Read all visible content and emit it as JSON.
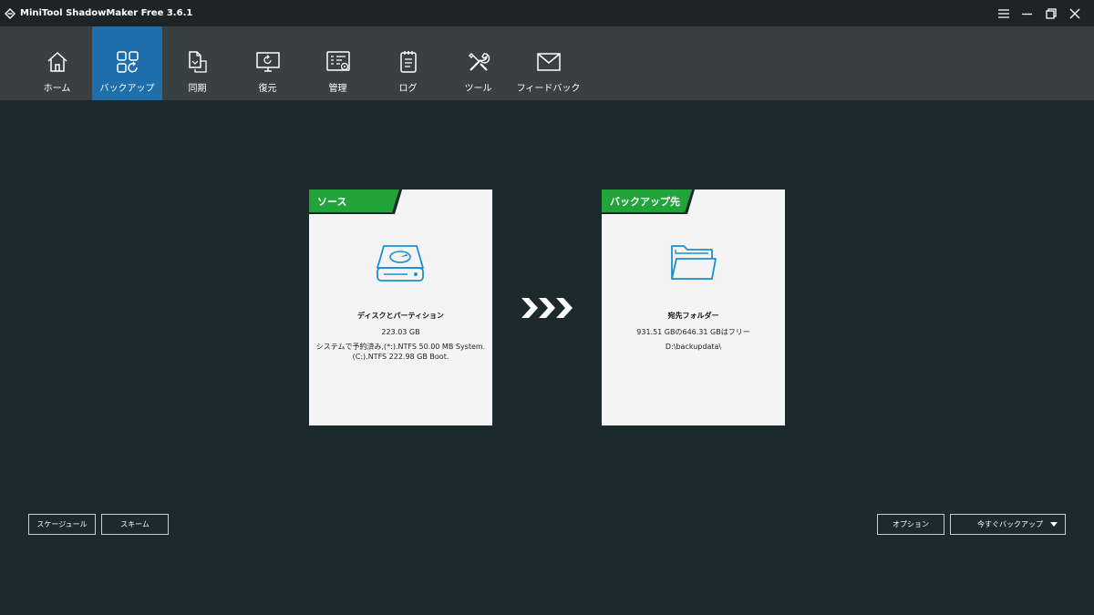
{
  "window": {
    "title": "MiniTool ShadowMaker Free 3.6.1",
    "controls": [
      "menu-icon",
      "minimize-icon",
      "restore-icon",
      "close-icon"
    ]
  },
  "nav": {
    "items": [
      {
        "label": "ホーム",
        "icon": "home-icon"
      },
      {
        "label": "バックアップ",
        "icon": "backup-icon",
        "active": true
      },
      {
        "label": "同期",
        "icon": "sync-icon"
      },
      {
        "label": "復元",
        "icon": "restore-monitor-icon"
      },
      {
        "label": "管理",
        "icon": "manage-icon"
      },
      {
        "label": "ログ",
        "icon": "log-icon"
      },
      {
        "label": "ツール",
        "icon": "tools-icon"
      },
      {
        "label": "フィードバック",
        "icon": "feedback-mail-icon"
      }
    ]
  },
  "source": {
    "tab_label": "ソース",
    "name": "ディスクとパーティション",
    "size": "223.03 GB",
    "detail_1": "システムで予約済み,(*:).NTFS 50.00 MB System.",
    "detail_2": "(C:).NTFS 222.98 GB Boot.",
    "icon": "hard-disk-icon"
  },
  "destination": {
    "tab_label": "バックアップ先",
    "name": "宛先フォルダー",
    "capacity": "931.51 GBの646.31 GBはフリー",
    "path": "D:\\backupdata\\",
    "icon": "folder-icon"
  },
  "buttons": {
    "schedule": "スケージュール",
    "scheme": "スキーム",
    "options": "オプション",
    "backup_now": "今すぐバックアップ"
  },
  "colors": {
    "background": "#1c2a2e",
    "navbar": "#3a3f41",
    "active_tab": "#1e6fa9",
    "card_tab": "#22a43a"
  }
}
